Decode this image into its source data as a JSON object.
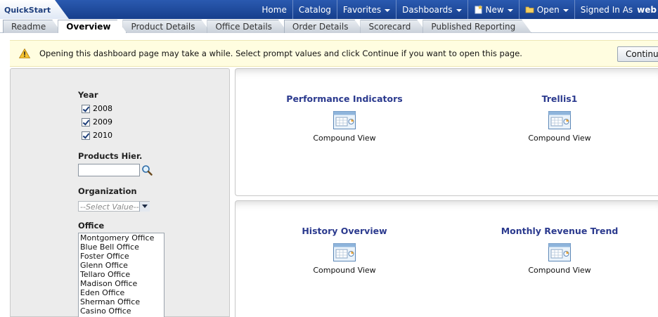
{
  "app": {
    "title": "QuickStart"
  },
  "globalnav": {
    "home": "Home",
    "catalog": "Catalog",
    "favorites": "Favorites",
    "dashboards": "Dashboards",
    "new": "New",
    "open": "Open",
    "signed_in_label": "Signed In As",
    "user": "web"
  },
  "tabs": [
    {
      "label": "Readme"
    },
    {
      "label": "Overview",
      "active": true
    },
    {
      "label": "Product Details"
    },
    {
      "label": "Office Details"
    },
    {
      "label": "Order Details"
    },
    {
      "label": "Scorecard"
    },
    {
      "label": "Published Reporting"
    }
  ],
  "notice": {
    "text": "Opening this dashboard page may take a while. Select prompt values and click Continue if you want to open this page.",
    "button": "Continue"
  },
  "prompts": {
    "year_label": "Year",
    "years": [
      "2008",
      "2009",
      "2010"
    ],
    "products_label": "Products Hier.",
    "products_value": "",
    "organization_label": "Organization",
    "organization_placeholder": "--Select Value--",
    "office_label": "Office",
    "offices": [
      "Montgomery Office",
      "Blue Bell Office",
      "Foster Office",
      "Glenn Office",
      "Tellaro Office",
      "Madison Office",
      "Eden Office",
      "Sherman Office",
      "Casino Office"
    ]
  },
  "sections": [
    {
      "views": [
        {
          "title": "Performance Indicators",
          "label": "Compound View"
        },
        {
          "title": "Trellis1",
          "label": "Compound View"
        }
      ]
    },
    {
      "views": [
        {
          "title": "History Overview",
          "label": "Compound View"
        },
        {
          "title": "Monthly Revenue Trend",
          "label": "Compound View"
        }
      ]
    }
  ]
}
